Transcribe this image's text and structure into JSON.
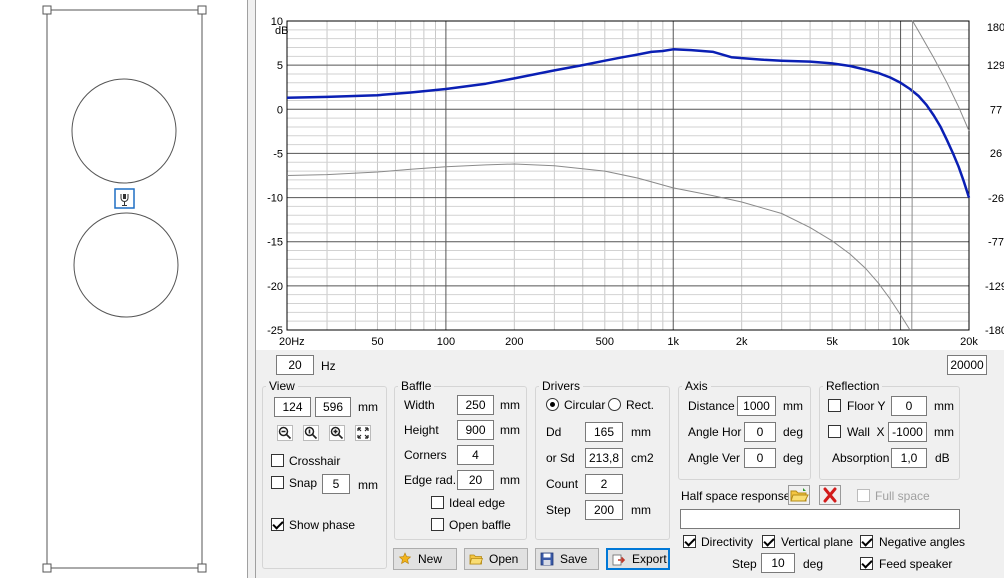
{
  "chart": {
    "left_axis_unit": "dB",
    "x_tick_labels": [
      "20Hz",
      "50",
      "100",
      "200",
      "500",
      "1k",
      "2k",
      "5k",
      "10k",
      "20k"
    ],
    "left_tick_labels": [
      "10",
      "5",
      "0",
      "-5",
      "-10",
      "-15",
      "-20",
      "-25"
    ],
    "right_tick_labels": [
      "180",
      "129",
      "77",
      "26",
      "-26",
      "-77",
      "-129",
      "-180"
    ]
  },
  "chart_data": {
    "type": "line",
    "xlabel": "",
    "ylabel": "dB",
    "xscale": "log",
    "xlim": [
      20,
      20000
    ],
    "ylim": [
      -25,
      10
    ],
    "y2lim": [
      -180,
      180
    ],
    "grid": true,
    "series": [
      {
        "axis": "left",
        "color": "#0a1fb4",
        "x": [
          20,
          30,
          50,
          70,
          100,
          150,
          200,
          300,
          400,
          500,
          600,
          700,
          800,
          900,
          1000,
          1200,
          1500,
          1800,
          2000,
          2500,
          3000,
          4000,
          5000,
          6000,
          7000,
          8000,
          9000,
          10000,
          11000,
          12000,
          13000,
          14000,
          15000,
          16000,
          17000,
          18000,
          19000,
          20000
        ],
        "y": [
          1.3,
          1.4,
          1.6,
          1.9,
          2.3,
          2.9,
          3.5,
          4.4,
          5.0,
          5.5,
          5.9,
          6.2,
          6.5,
          6.6,
          6.8,
          6.7,
          6.5,
          5.9,
          5.8,
          5.6,
          5.5,
          5.4,
          5.2,
          4.9,
          4.5,
          4.1,
          3.6,
          3.0,
          2.3,
          1.5,
          0.5,
          -0.7,
          -2.0,
          -3.5,
          -5.0,
          -6.5,
          -8.2,
          -10.0
        ]
      },
      {
        "axis": "left",
        "color": "#8a8a8a",
        "x": [
          20,
          30,
          50,
          70,
          100,
          150,
          200,
          300,
          500,
          700,
          1000,
          1500,
          2000,
          3000,
          4000,
          5000,
          6000,
          7000,
          8000,
          9000,
          10000,
          11000
        ],
        "y": [
          -7.5,
          -7.4,
          -7.1,
          -6.8,
          -6.5,
          -6.3,
          -6.2,
          -6.4,
          -7.0,
          -7.8,
          -8.9,
          -9.8,
          -10.5,
          -11.8,
          -13.4,
          -14.9,
          -16.4,
          -18.0,
          -19.7,
          -21.5,
          -23.3,
          -25.0
        ]
      },
      {
        "axis": "right",
        "color": "#8a8a8a",
        "x": [
          11200,
          11300,
          12000,
          14000,
          16000,
          18000,
          20000
        ],
        "y": [
          -180,
          180,
          168,
          137,
          108,
          80,
          52
        ]
      }
    ]
  },
  "freq_range": {
    "min_value": "20",
    "unit": "Hz",
    "max_value": "20000"
  },
  "view": {
    "title": "View",
    "width": "124",
    "height": "596",
    "unit": "mm",
    "tool_icons": [
      "zoom-out-icon",
      "zoom-fit-icon",
      "zoom-in-icon",
      "fullscreen-icon"
    ],
    "crosshair_label": "Crosshair",
    "crosshair_checked": false,
    "snap_label": "Snap",
    "snap_checked": false,
    "snap_value": "5",
    "snap_unit": "mm",
    "show_phase_label": "Show phase",
    "show_phase_checked": true
  },
  "baffle": {
    "title": "Baffle",
    "width_label": "Width",
    "width_value": "250",
    "width_unit": "mm",
    "height_label": "Height",
    "height_value": "900",
    "height_unit": "mm",
    "corners_label": "Corners",
    "corners_value": "4",
    "edge_rad_label": "Edge rad.",
    "edge_rad_value": "20",
    "edge_rad_unit": "mm",
    "ideal_edge_label": "Ideal edge",
    "open_baffle_label": "Open baffle"
  },
  "drivers": {
    "title": "Drivers",
    "circular_label": "Circular",
    "rect_label": "Rect.",
    "dd_label": "Dd",
    "dd_value": "165",
    "dd_unit": "mm",
    "sd_label": "or Sd",
    "sd_value": "213,8",
    "sd_unit": "cm2",
    "count_label": "Count",
    "count_value": "2",
    "step_label": "Step",
    "step_value": "200",
    "step_unit": "mm"
  },
  "axis": {
    "title": "Axis",
    "distance_label": "Distance",
    "distance_value": "1000",
    "distance_unit": "mm",
    "angle_hor_label": "Angle Hor",
    "angle_hor_value": "0",
    "angle_hor_unit": "deg",
    "angle_ver_label": "Angle Ver",
    "angle_ver_value": "0",
    "angle_ver_unit": "deg"
  },
  "reflection": {
    "title": "Reflection",
    "floor_label": "Floor Y",
    "floor_value": "0",
    "floor_unit": "mm",
    "wall_label": "Wall  X",
    "wall_value": "-1000",
    "wall_unit": "mm",
    "absorption_label": "Absorption",
    "absorption_value": "1,0",
    "absorption_unit": "dB"
  },
  "half_space": {
    "label": "Half space response",
    "full_space_label": "Full space",
    "path_value": ""
  },
  "options": {
    "directivity_label": "Directivity",
    "vertical_plane_label": "Vertical plane",
    "negative_angles_label": "Negative angles",
    "step_label": "Step",
    "step_value": "10",
    "step_unit": "deg",
    "feed_speaker_label": "Feed speaker"
  },
  "buttons": {
    "new_label": "New",
    "open_label": "Open",
    "save_label": "Save",
    "export_label": "Export"
  },
  "colors": {
    "response_curve": "#0a1fb4",
    "secondary_curve": "#8a8a8a",
    "accent": "#0078d7"
  }
}
